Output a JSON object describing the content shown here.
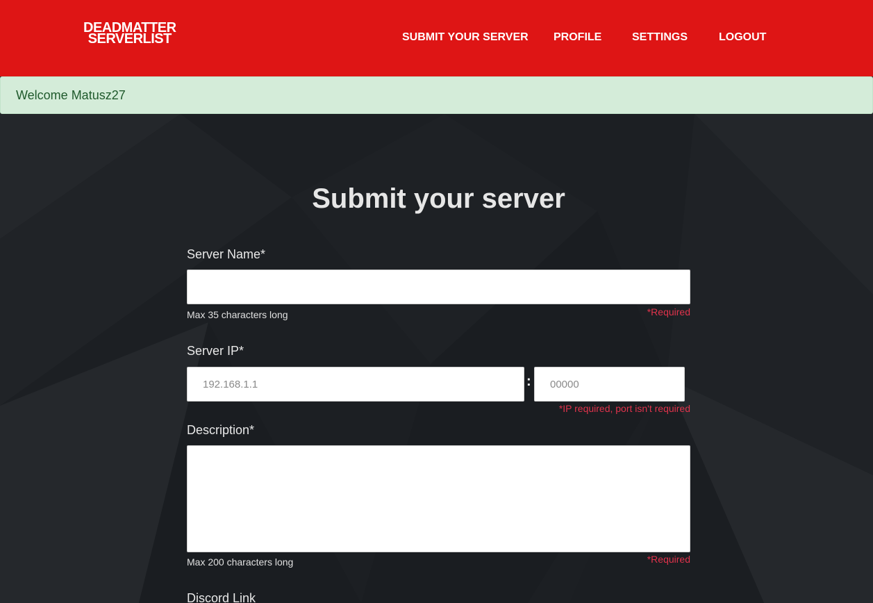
{
  "logo": {
    "line1": "DEADMATTER",
    "line2": "SERVERLIST"
  },
  "nav": {
    "submit": "SUBMIT YOUR SERVER",
    "profile": "PROFILE",
    "settings": "SETTINGS",
    "logout": "LOGOUT"
  },
  "alert": {
    "text": "Welcome Matusz27"
  },
  "form": {
    "title": "Submit your server",
    "server_name": {
      "label": "Server Name*",
      "value": "",
      "hint": "Max 35 characters long",
      "required": "*Required"
    },
    "server_ip": {
      "label": "Server IP*",
      "ip_placeholder": "192.168.1.1",
      "separator": ":",
      "port_placeholder": "00000",
      "required": "*IP required, port isn't required"
    },
    "description": {
      "label": "Description*",
      "value": "",
      "hint": "Max 200 characters long",
      "required": "*Required"
    },
    "discord": {
      "label": "Discord Link"
    }
  },
  "colors": {
    "header": "#de1515",
    "alert_bg": "#d4ecd9",
    "alert_text": "#1f5a2c",
    "page_bg": "#1c1f23",
    "required_text": "#e0334c"
  }
}
